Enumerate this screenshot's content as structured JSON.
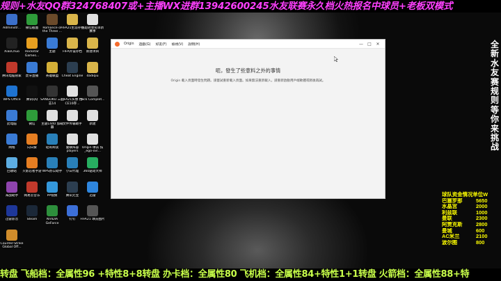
{
  "top_banner": {
    "text1": "规则+水友QQ群324768407或+主播WX进群13942600245",
    "text2": "水友联赛永久档火热报名中球员+老板双模式"
  },
  "desktop_icons": [
    {
      "label": "Administr...",
      "color": "#3b6fc9"
    },
    {
      "label": "微信截图",
      "color": "#2e9b3a"
    },
    {
      "label": "Romance of the Three ...",
      "color": "#6b4a2a"
    },
    {
      "label": "FIFA21生涯存档",
      "color": "#d9b54a"
    },
    {
      "label": "英超转会名单新赛季",
      "color": "#e0e0e0"
    },
    {
      "label": "XiaoChuo",
      "color": "#222222"
    },
    {
      "label": "Rockstar Games...",
      "color": "#e8a020"
    },
    {
      "label": "主题",
      "color": "#3a7bd5"
    },
    {
      "label": "FIFA外设存档",
      "color": "#d9b54a"
    },
    {
      "label": "新建项目",
      "color": "#d9b54a"
    },
    {
      "label": "腾讯电脑管家",
      "color": "#c0392b"
    },
    {
      "label": "虎牙直播",
      "color": "#3a7bd5"
    },
    {
      "label": "英雄联盟",
      "color": "#d4af37"
    },
    {
      "label": "Cheat Engine",
      "color": "#2c3e50"
    },
    {
      "label": "dadiqiu",
      "color": "#d9b54a"
    },
    {
      "label": "WPS Office",
      "color": "#1e73d1"
    },
    {
      "label": "腾讯QQ",
      "color": "#111111"
    },
    {
      "label": "SANGOKU 三国志14",
      "color": "#333333"
    },
    {
      "label": "FIFA21头像 档-CE10存...",
      "color": "#e0e0e0"
    },
    {
      "label": "Nick Complet...",
      "color": "#555555"
    },
    {
      "label": "此电脑",
      "color": "#3a7bd5"
    },
    {
      "label": "微信",
      "color": "#2e9b3a"
    },
    {
      "label": "主题1440 加载器",
      "color": "#e0e0e0"
    },
    {
      "label": "文件传输助手",
      "color": "#e0e0e0"
    },
    {
      "label": "新建",
      "color": "#e0e0e0"
    },
    {
      "label": "网络",
      "color": "#3a7bd5"
    },
    {
      "label": "向日葵",
      "color": "#e67e22"
    },
    {
      "label": "轻舟阅读",
      "color": "#2980b9"
    },
    {
      "label": "曼联阵容 players",
      "color": "#e0e0e0"
    },
    {
      "label": "Origin 球员 技_ego-ovi...",
      "color": "#e0e0e0"
    },
    {
      "label": "回收站",
      "color": "#5dade2"
    },
    {
      "label": "火影忍者手游",
      "color": "#e67e22"
    },
    {
      "label": "WPS办公助手",
      "color": "#2980b9"
    },
    {
      "label": "小白代理",
      "color": "#2980b9"
    },
    {
      "label": "360驱动大师",
      "color": "#27ae60"
    },
    {
      "label": "海战助手",
      "color": "#8e44ad"
    },
    {
      "label": "网易云音乐",
      "color": "#c0392b"
    },
    {
      "label": "PP视频",
      "color": "#3498db"
    },
    {
      "label": "腾讯元宝",
      "color": "#2c3e50"
    },
    {
      "label": "迅雷",
      "color": "#2e86de"
    },
    {
      "label": "迅雷影音",
      "color": "#1e3799"
    },
    {
      "label": "Steam",
      "color": "#1b2838"
    },
    {
      "label": "NVIDIA GeForce",
      "color": "#2d8f3c"
    },
    {
      "label": "钉钉",
      "color": "#3c6fd8"
    },
    {
      "label": "FIFA21 球员图片",
      "color": "#555555"
    },
    {
      "label": "Counter-Strike Global Off...",
      "color": "#d08c2b"
    }
  ],
  "window": {
    "app_name": "Origin",
    "menu": [
      "遊戲(G)",
      "好友(F)",
      "檢視(V)",
      "說明(H)"
    ],
    "error_title": "呃，發生了些意料之外的事情",
    "error_message": "Origin 載入頁面時發生問題。請嘗試重新載入頁面。如果無法重新載入，請重新啟動用戶端軟體或稍後再試。",
    "minimize": "—",
    "maximize": "□",
    "close": "✕"
  },
  "right_vertical_text": "全新水友赛规则等你来挑战",
  "fund_table": {
    "title": "球队资金情况单位W",
    "rows": [
      {
        "name": "巴塞罗那",
        "value": "5650"
      },
      {
        "name": "水晶宫",
        "value": "2000"
      },
      {
        "name": "利兹联",
        "value": "1000"
      },
      {
        "name": "曼联",
        "value": "2300"
      },
      {
        "name": "阿贾克斯",
        "value": "2800"
      },
      {
        "name": "曼城",
        "value": "600"
      },
      {
        "name": "AC米兰",
        "value": "2100"
      },
      {
        "name": "波尔图",
        "value": "800"
      }
    ]
  },
  "bottom_banner": {
    "text": "转盘 飞船档：全属性96 +特性8+8转盘 办卡档：全属性80 飞机档：全属性84+特性1+1转盘 火箭档：全属性88+特"
  }
}
